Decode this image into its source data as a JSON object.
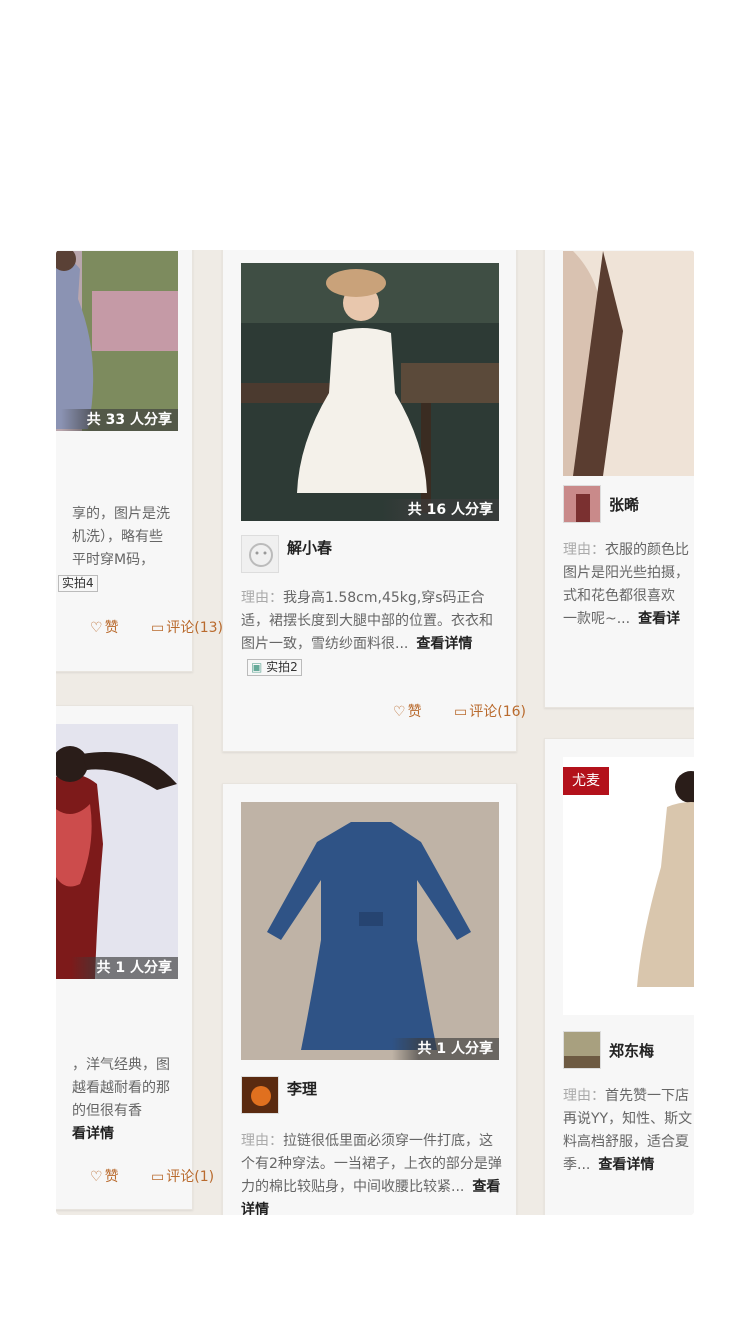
{
  "cards": [
    {
      "share": "共 33 人分享",
      "reason_tail": [
        "享的，图片是洗",
        "机洗），略有些",
        "平时穿M码，"
      ],
      "badge": "实拍4",
      "like": "赞",
      "comment": "评论(13)"
    },
    {
      "share": "共 1 人分享",
      "reason_tail": [
        "，洋气经典，图",
        "越看越耐看的那",
        "的但很有香"
      ],
      "more": "看详情",
      "like": "赞",
      "comment": "评论(1)"
    },
    {
      "share": "共 16 人分享",
      "user": "解小春",
      "label": "理由：",
      "reason": "我身高1.58cm,45kg,穿s码正合适，裙摆长度到大腿中部的位置。衣衣和图片一致，雪纺纱面料很...",
      "more": "查看详情",
      "badge": "实拍2",
      "like": "赞",
      "comment": "评论(16)"
    },
    {
      "share": "共 1 人分享",
      "user": "李理",
      "label": "理由：",
      "reason": "拉链很低里面必须穿一件打底，这个有2种穿法。一当裙子，上衣的部分是弹力的棉比较贴身，中间收腰比较紧...",
      "more": "查看详情"
    },
    {
      "user": "张晞",
      "label": "理由：",
      "reason_lines": [
        "衣服的颜色比",
        "图片是阳光些拍摄，",
        "式和花色都很喜欢",
        "一款呢~..."
      ],
      "more": "查看详"
    },
    {
      "brand": "尤麦",
      "user": "郑东梅",
      "label": "理由：",
      "reason_lines": [
        "首先赞一下店",
        "再说YY，知性、斯文",
        "料高档舒服，适合夏",
        "季..."
      ],
      "more": "查看详情"
    }
  ]
}
